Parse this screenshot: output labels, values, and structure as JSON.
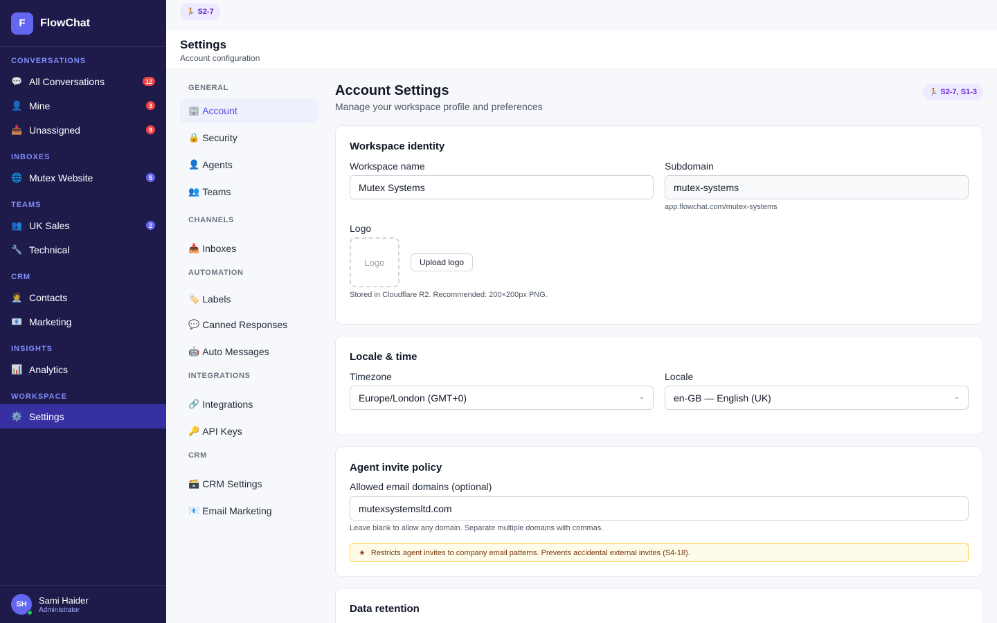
{
  "app": {
    "name": "FlowChat",
    "logo_letter": "F"
  },
  "sidebar": {
    "sections": {
      "conversations": "CONVERSATIONS",
      "inboxes": "INBOXES",
      "teams": "TEAMS",
      "crm": "CRM",
      "insights": "INSIGHTS",
      "workspace": "WORKSPACE"
    },
    "items": {
      "all_conversations": {
        "label": "All Conversations",
        "icon": "💬",
        "badge": "12"
      },
      "mine": {
        "label": "Mine",
        "icon": "👤",
        "badge": "3"
      },
      "unassigned": {
        "label": "Unassigned",
        "icon": "📥",
        "badge": "9"
      },
      "mutex_website": {
        "label": "Mutex Website",
        "icon": "🌐",
        "badge": "5"
      },
      "uk_sales": {
        "label": "UK Sales",
        "icon": "👥",
        "badge": "2"
      },
      "technical": {
        "label": "Technical",
        "icon": "🔧"
      },
      "contacts": {
        "label": "Contacts",
        "icon": "🧑‍💼"
      },
      "marketing": {
        "label": "Marketing",
        "icon": "📧"
      },
      "analytics": {
        "label": "Analytics",
        "icon": "📊"
      },
      "settings": {
        "label": "Settings",
        "icon": "⚙️"
      }
    },
    "user": {
      "initials": "SH",
      "name": "Sami Haider",
      "role": "Administrator"
    }
  },
  "topstrip": {
    "pill_icon": "🏃",
    "pill_label": "S2-7"
  },
  "header": {
    "title": "Settings",
    "subtitle": "Account configuration"
  },
  "settings_nav": {
    "sections": {
      "general": "GENERAL",
      "channels": "CHANNELS",
      "automation": "AUTOMATION",
      "integrations": "INTEGRATIONS",
      "crm": "CRM"
    },
    "items": {
      "account": {
        "label": "Account",
        "icon": "🏢"
      },
      "security": {
        "label": "Security",
        "icon": "🔒"
      },
      "agents": {
        "label": "Agents",
        "icon": "👤"
      },
      "teams": {
        "label": "Teams",
        "icon": "👥"
      },
      "inboxes": {
        "label": "Inboxes",
        "icon": "📥"
      },
      "labels": {
        "label": "Labels",
        "icon": "🏷️"
      },
      "canned_responses": {
        "label": "Canned Responses",
        "icon": "💬"
      },
      "auto_messages": {
        "label": "Auto Messages",
        "icon": "🤖"
      },
      "integrations": {
        "label": "Integrations",
        "icon": "🔗"
      },
      "api_keys": {
        "label": "API Keys",
        "icon": "🔑"
      },
      "crm_settings": {
        "label": "CRM Settings",
        "icon": "🗃️"
      },
      "email_marketing": {
        "label": "Email Marketing",
        "icon": "📧"
      }
    }
  },
  "main": {
    "title": "Account Settings",
    "subtitle": "Manage your workspace profile and preferences",
    "pill_icon": "🏃",
    "pill_label": "S2-7, S1-3",
    "workspace_identity": {
      "title": "Workspace identity",
      "name_label": "Workspace name",
      "name_value": "Mutex Systems",
      "subdomain_label": "Subdomain",
      "subdomain_value": "mutex-systems",
      "subdomain_help": "app.flowchat.com/mutex-systems",
      "logo_label": "Logo",
      "logo_placeholder": "Logo",
      "upload_button": "Upload logo",
      "logo_help": "Stored in Cloudflare R2. Recommended: 200×200px PNG."
    },
    "locale_time": {
      "title": "Locale & time",
      "timezone_label": "Timezone",
      "timezone_value": "Europe/London (GMT+0)",
      "locale_label": "Locale",
      "locale_value": "en-GB — English (UK)"
    },
    "invite_policy": {
      "title": "Agent invite policy",
      "domains_label": "Allowed email domains (optional)",
      "domains_value": "mutexsystemsltd.com",
      "domains_help": "Leave blank to allow any domain. Separate multiple domains with commas.",
      "notice": "Restricts agent invites to company email patterns. Prevents accidental external invites (S4-18)."
    },
    "data_retention": {
      "title": "Data retention"
    }
  },
  "colors": {
    "sidebar_bg": "#1e1b4b",
    "accent": "#6366f1",
    "active_nav": "#3730a3",
    "badge_red": "#ef4444"
  }
}
